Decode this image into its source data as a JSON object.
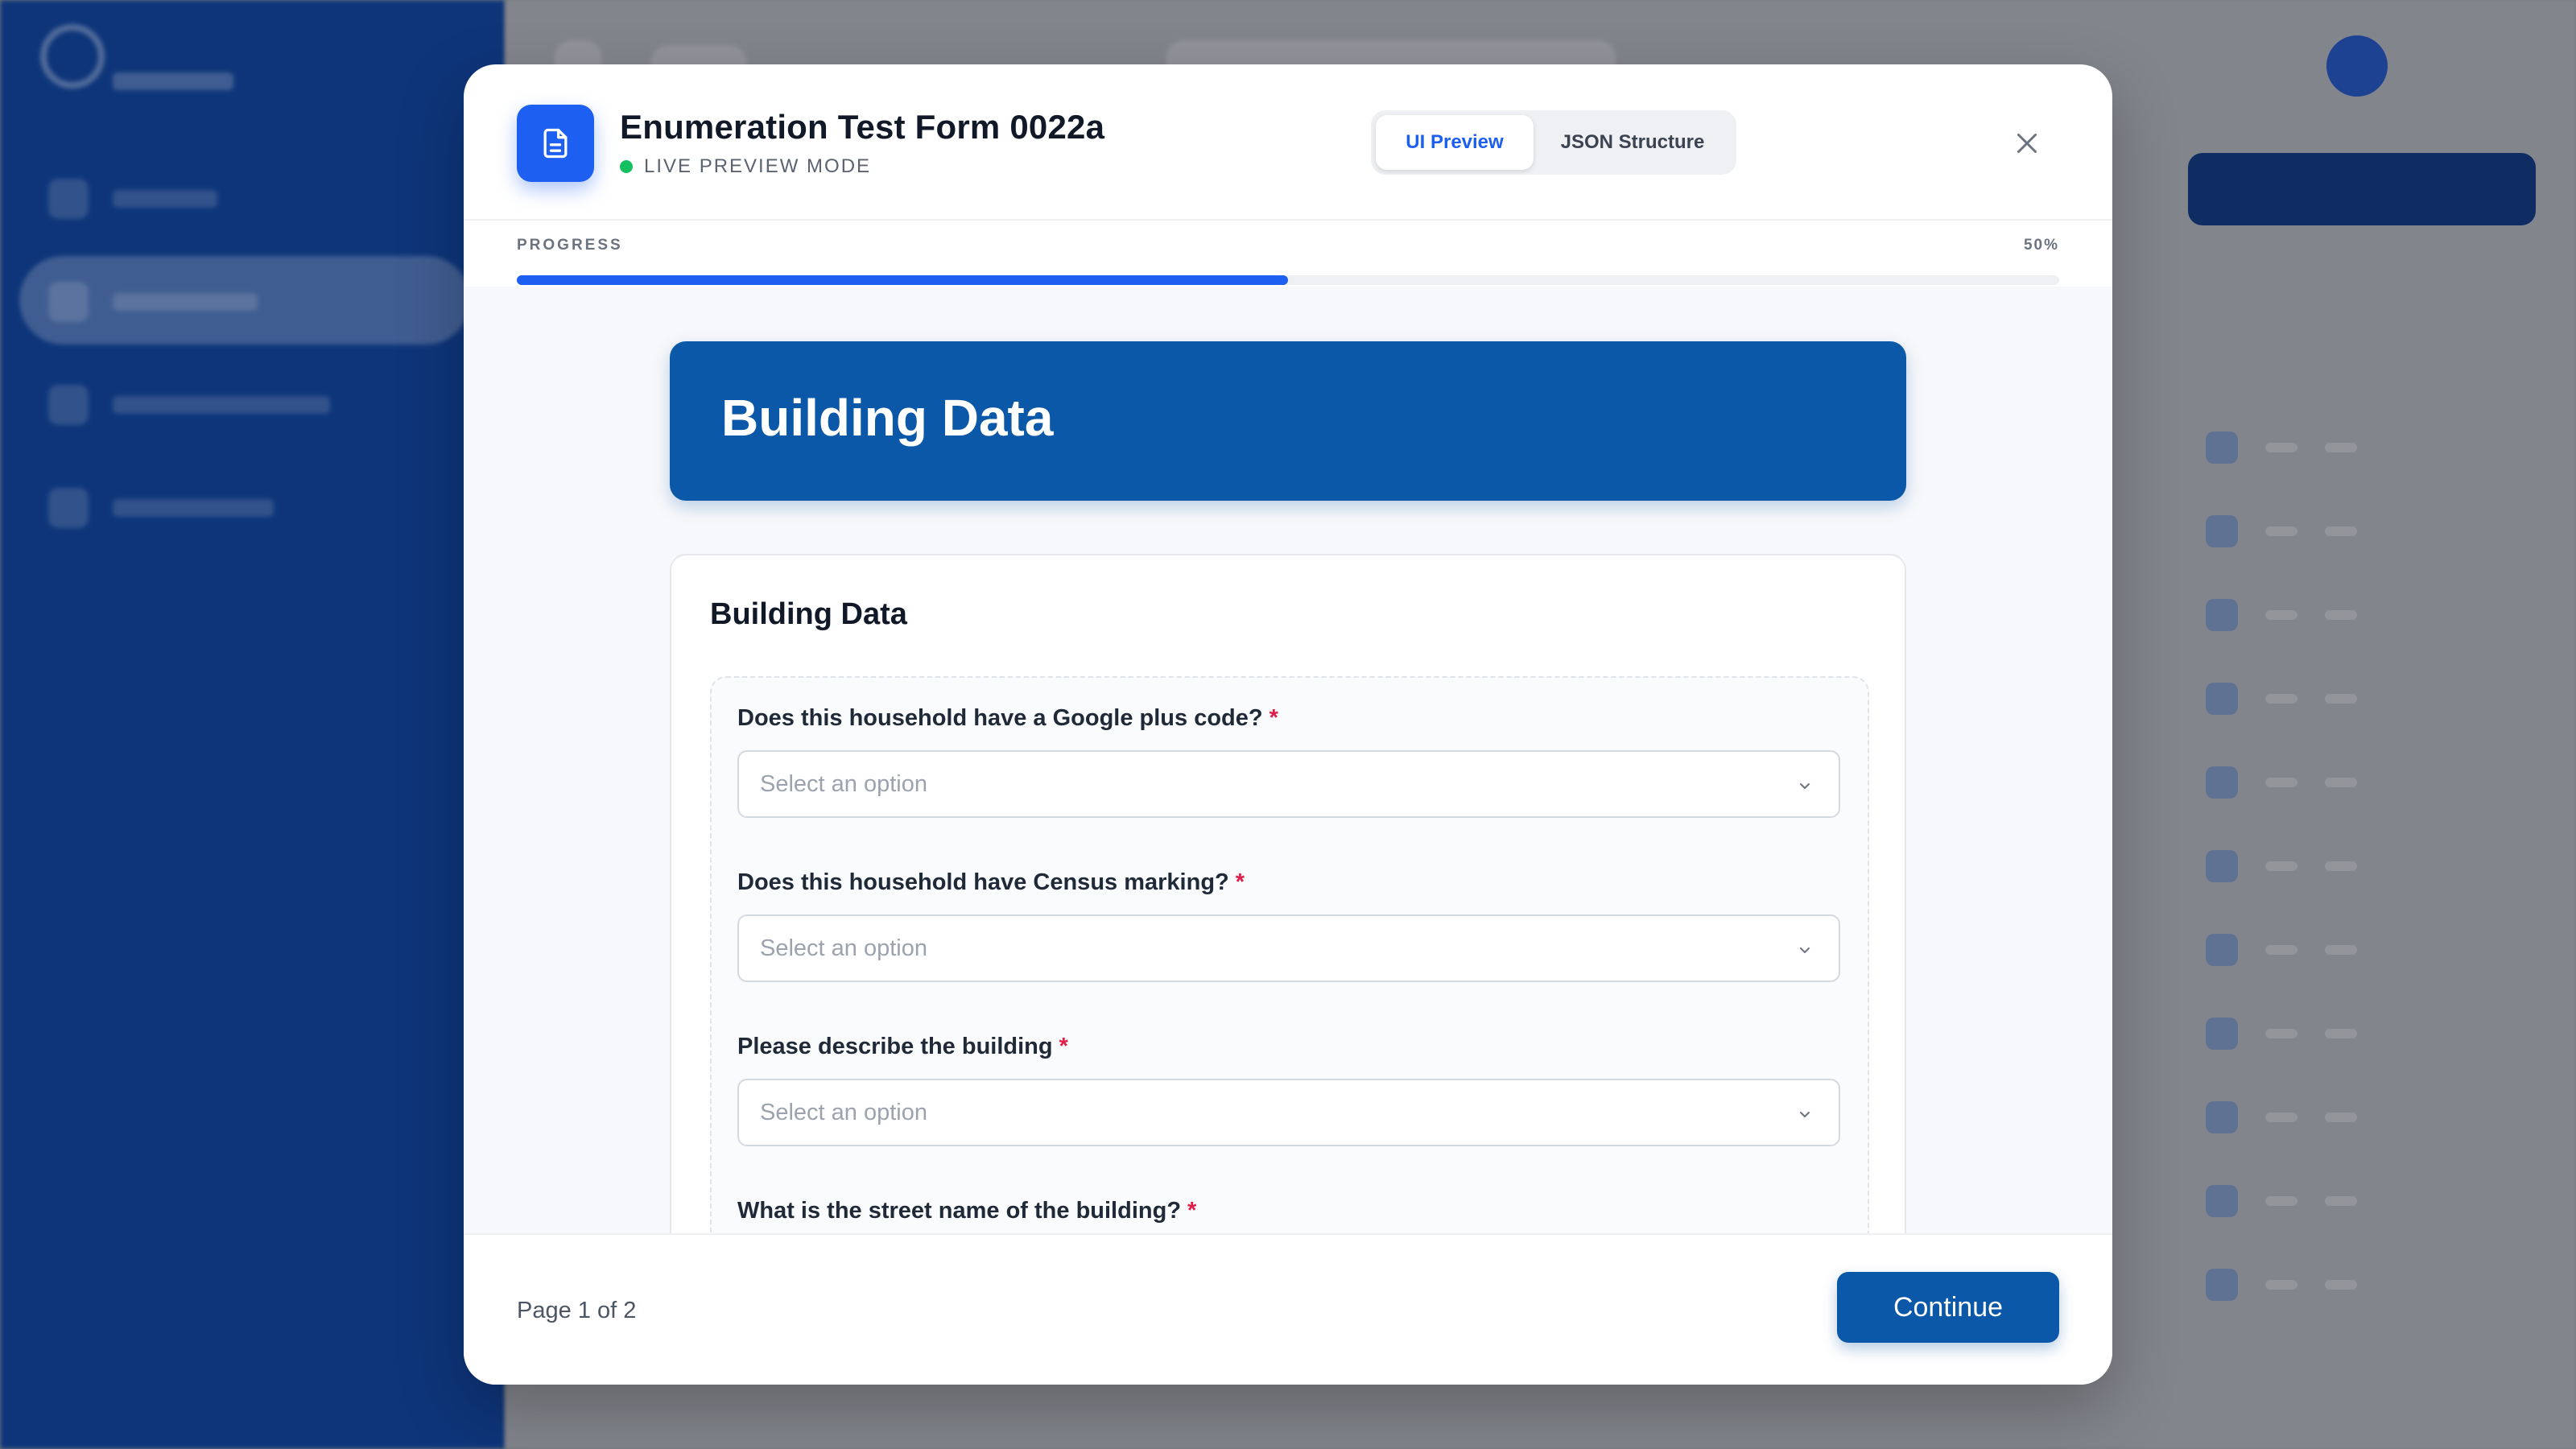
{
  "modal": {
    "title": "Enumeration Test Form 0022a",
    "status_text": "LIVE PREVIEW MODE",
    "status_color": "#16c060",
    "accent_color": "#1d5ff0",
    "brand_color": "#0c58a8",
    "tabs": [
      {
        "label": "UI Preview",
        "active": true
      },
      {
        "label": "JSON Structure",
        "active": false
      }
    ],
    "close_icon": "close-icon",
    "document_icon": "document-icon"
  },
  "progress": {
    "label": "PROGRESS",
    "percent_text": "50%",
    "value": 0.5
  },
  "section": {
    "banner_title": "Building Data",
    "card_title": "Building Data",
    "questions": [
      {
        "label": "Does this household have a Google plus code?",
        "required_mark": "*",
        "placeholder": "Select an option"
      },
      {
        "label": "Does this household have Census marking?",
        "required_mark": "*",
        "placeholder": "Select an option"
      },
      {
        "label": "Please describe the building",
        "required_mark": "*",
        "placeholder": "Select an option"
      },
      {
        "label": "What is the street name of the building?",
        "required_mark": "*"
      }
    ]
  },
  "footer": {
    "page_indicator": "Page 1 of 2",
    "continue_label": "Continue"
  }
}
